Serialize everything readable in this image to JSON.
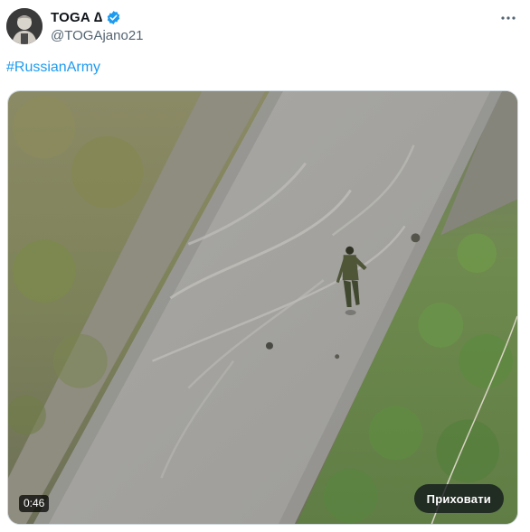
{
  "author": {
    "display_name": "TOGA",
    "name_symbol": "∆",
    "handle": "@TOGAjano21",
    "verified_color": "#1d9bf0"
  },
  "menu": {
    "icon": "more-horizontal-icon"
  },
  "tweet": {
    "hashtag": "#RussianArmy",
    "link_color": "#1d9bf0"
  },
  "video": {
    "duration": "0:46",
    "hide_label": "Приховати"
  }
}
